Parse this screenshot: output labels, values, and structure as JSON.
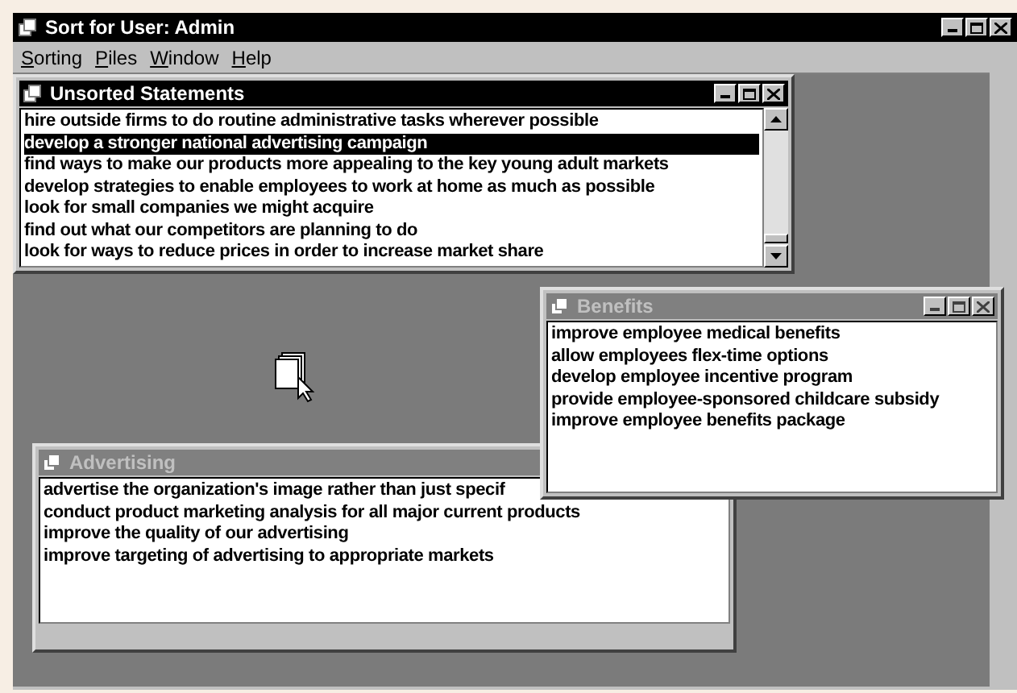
{
  "window": {
    "title": "Sort for User: Admin",
    "active": true
  },
  "menu": [
    {
      "label": "Sorting"
    },
    {
      "label": "Piles"
    },
    {
      "label": "Window"
    },
    {
      "label": "Help"
    }
  ],
  "child_windows": [
    {
      "title": "Unsorted Statements",
      "active": true,
      "scrollbar": true,
      "items": [
        {
          "text": "hire outside firms to do routine administrative tasks wherever possible",
          "selected": false
        },
        {
          "text": "develop a stronger national advertising campaign",
          "selected": true
        },
        {
          "text": "find ways to make our products more appealing to the key young adult markets",
          "selected": false
        },
        {
          "text": "develop strategies to enable employees to work at home as much as possible",
          "selected": false
        },
        {
          "text": "look for small companies we might acquire",
          "selected": false
        },
        {
          "text": "find out what our competitors are planning to do",
          "selected": false
        },
        {
          "text": "look for ways to reduce prices in order to increase market share",
          "selected": false
        }
      ]
    },
    {
      "title": "Benefits",
      "active": false,
      "scrollbar": false,
      "items": [
        {
          "text": "improve employee medical benefits",
          "selected": false
        },
        {
          "text": "allow employees flex-time options",
          "selected": false
        },
        {
          "text": "develop employee incentive program",
          "selected": false
        },
        {
          "text": "provide employee-sponsored childcare subsidy",
          "selected": false
        },
        {
          "text": "improve employee benefits package",
          "selected": false
        }
      ]
    },
    {
      "title": "Advertising",
      "active": false,
      "scrollbar": false,
      "items": [
        {
          "text": "advertise the organization's image rather than just specif",
          "selected": false
        },
        {
          "text": "conduct product marketing analysis for all major current products",
          "selected": false
        },
        {
          "text": "improve the quality of our advertising",
          "selected": false
        },
        {
          "text": "improve targeting of advertising to appropriate markets",
          "selected": false
        }
      ]
    }
  ]
}
